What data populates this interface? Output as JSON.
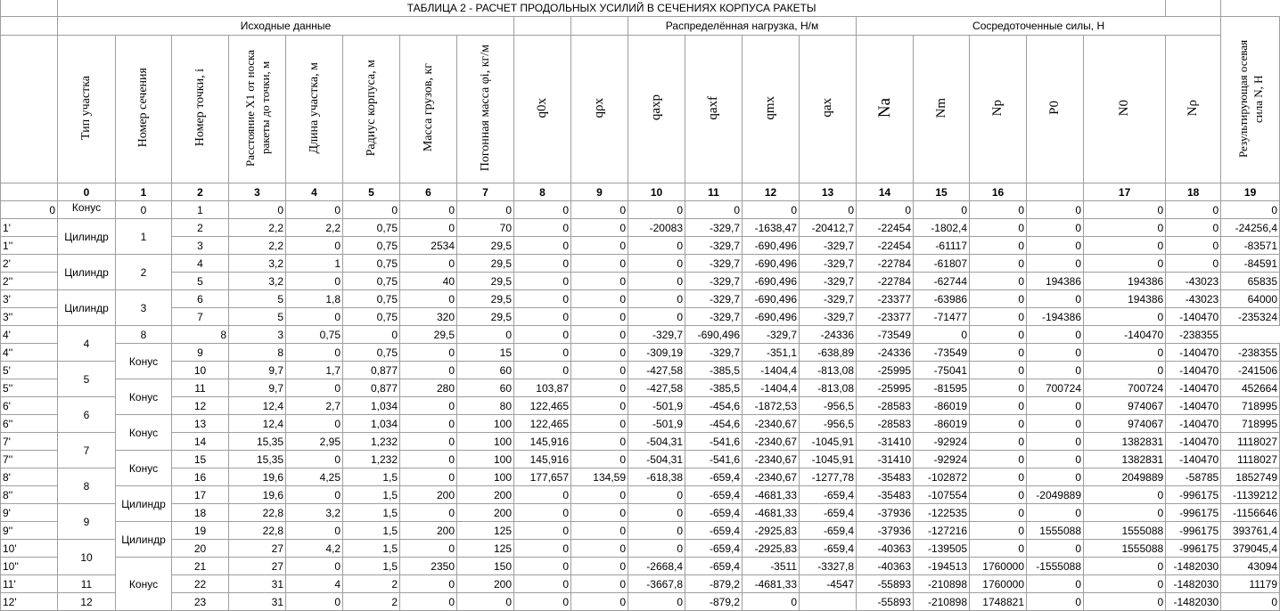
{
  "title": "ТАБЛИЦА 2  - РАСЧЕТ ПРОДОЛЬНЫХ УСИЛИЙ В СЕЧЕНИЯХ КОРПУСА РАКЕТЫ",
  "groups": {
    "source": "Исходные данные",
    "distributed": "Распределённая нагрузка, Н/м",
    "concentrated": "Сосредоточенные силы, Н"
  },
  "headers": {
    "c1": "Тип участка",
    "c2": "Номер сечения",
    "c3": "Номер точки, i",
    "c4": "Расстояние X1 от носка ракеты до точки, м",
    "c5": "Длина участка, м",
    "c6": "Радиус корпуса, м",
    "c7": "Масса грузов, кг",
    "c8": "Погонная масса φi, кг/м",
    "c9": "q0x",
    "c10": "qρx",
    "c11": "qaxp",
    "c12": "qaxf",
    "c13": "qmx",
    "c14": "qax",
    "c15": "Na",
    "c16": "Nm",
    "c17": "Np",
    "c18": "P0",
    "c19": "N0",
    "c20": "Nρ",
    "c21": "Результирующая осевая сила N, Н"
  },
  "col_numbers": [
    "0",
    "1",
    "2",
    "3",
    "4",
    "5",
    "6",
    "7",
    "8",
    "9",
    "10",
    "11",
    "12",
    "13",
    "14",
    "15",
    "16",
    "",
    "17",
    "18",
    "19"
  ],
  "types": [
    "Конус",
    "Цилиндр",
    "Цилиндр",
    "Цилиндр",
    "Конус",
    "Конус",
    "Конус",
    "Конус",
    "Цилиндр",
    "Цилиндр",
    "Конус"
  ],
  "sections": [
    "0",
    "1",
    "2",
    "3",
    "4",
    "5",
    "6",
    "7",
    "8",
    "9",
    "10",
    "11",
    "12"
  ],
  "rows": [
    [
      "0",
      "1",
      "0",
      "0",
      "0",
      "0",
      "0",
      "0",
      "0",
      "0",
      "0",
      "0",
      "0",
      "0",
      "0",
      "0",
      "0",
      "0",
      "0",
      "0"
    ],
    [
      "1'",
      "2",
      "2,2",
      "2,2",
      "0,75",
      "0",
      "70",
      "0",
      "0",
      "-20083",
      "-329,7",
      "-1638,47",
      "-20412,7",
      "-22454",
      "-1802,4",
      "0",
      "0",
      "0",
      "0",
      "-24256,4"
    ],
    [
      "1''",
      "3",
      "2,2",
      "0",
      "0,75",
      "2534",
      "29,5",
      "0",
      "0",
      "0",
      "-329,7",
      "-690,496",
      "-329,7",
      "-22454",
      "-61117",
      "0",
      "0",
      "0",
      "0",
      "-83571"
    ],
    [
      "2'",
      "4",
      "3,2",
      "1",
      "0,75",
      "0",
      "29,5",
      "0",
      "0",
      "0",
      "-329,7",
      "-690,496",
      "-329,7",
      "-22784",
      "-61807",
      "0",
      "0",
      "0",
      "0",
      "-84591"
    ],
    [
      "2''",
      "5",
      "3,2",
      "0",
      "0,75",
      "40",
      "29,5",
      "0",
      "0",
      "0",
      "-329,7",
      "-690,496",
      "-329,7",
      "-22784",
      "-62744",
      "0",
      "194386",
      "194386",
      "-43023",
      "65835"
    ],
    [
      "3'",
      "6",
      "5",
      "1,8",
      "0,75",
      "0",
      "29,5",
      "0",
      "0",
      "0",
      "-329,7",
      "-690,496",
      "-329,7",
      "-23377",
      "-63986",
      "0",
      "0",
      "194386",
      "-43023",
      "64000"
    ],
    [
      "3''",
      "7",
      "5",
      "0",
      "0,75",
      "320",
      "29,5",
      "0",
      "0",
      "0",
      "-329,7",
      "-690,496",
      "-329,7",
      "-23377",
      "-71477",
      "0",
      "-194386",
      "0",
      "-140470",
      "-235324"
    ],
    [
      "4'",
      "8",
      "8",
      "3",
      "0,75",
      "0",
      "29,5",
      "0",
      "0",
      "0",
      "-329,7",
      "-690,496",
      "-329,7",
      "-24336",
      "-73549",
      "0",
      "0",
      "0",
      "-140470",
      "-238355"
    ],
    [
      "4''",
      "9",
      "8",
      "0",
      "0,75",
      "0",
      "15",
      "0",
      "0",
      "-309,19",
      "-329,7",
      "-351,1",
      "-638,89",
      "-24336",
      "-73549",
      "0",
      "0",
      "0",
      "-140470",
      "-238355"
    ],
    [
      "5'",
      "10",
      "9,7",
      "1,7",
      "0,877",
      "0",
      "60",
      "0",
      "0",
      "-427,58",
      "-385,5",
      "-1404,4",
      "-813,08",
      "-25995",
      "-75041",
      "0",
      "0",
      "0",
      "-140470",
      "-241506"
    ],
    [
      "5''",
      "11",
      "9,7",
      "0",
      "0,877",
      "280",
      "60",
      "103,87",
      "0",
      "-427,58",
      "-385,5",
      "-1404,4",
      "-813,08",
      "-25995",
      "-81595",
      "0",
      "700724",
      "700724",
      "-140470",
      "452664"
    ],
    [
      "6'",
      "12",
      "12,4",
      "2,7",
      "1,034",
      "0",
      "80",
      "122,465",
      "0",
      "-501,9",
      "-454,6",
      "-1872,53",
      "-956,5",
      "-28583",
      "-86019",
      "0",
      "0",
      "974067",
      "-140470",
      "718995"
    ],
    [
      "6''",
      "13",
      "12,4",
      "0",
      "1,034",
      "0",
      "100",
      "122,465",
      "0",
      "-501,9",
      "-454,6",
      "-2340,67",
      "-956,5",
      "-28583",
      "-86019",
      "0",
      "0",
      "974067",
      "-140470",
      "718995"
    ],
    [
      "7'",
      "14",
      "15,35",
      "2,95",
      "1,232",
      "0",
      "100",
      "145,916",
      "0",
      "-504,31",
      "-541,6",
      "-2340,67",
      "-1045,91",
      "-31410",
      "-92924",
      "0",
      "0",
      "1382831",
      "-140470",
      "1118027"
    ],
    [
      "7''",
      "15",
      "15,35",
      "0",
      "1,232",
      "0",
      "100",
      "145,916",
      "0",
      "-504,31",
      "-541,6",
      "-2340,67",
      "-1045,91",
      "-31410",
      "-92924",
      "0",
      "0",
      "1382831",
      "-140470",
      "1118027"
    ],
    [
      "8'",
      "16",
      "19,6",
      "4,25",
      "1,5",
      "0",
      "100",
      "177,657",
      "134,59",
      "-618,38",
      "-659,4",
      "-2340,67",
      "-1277,78",
      "-35483",
      "-102872",
      "0",
      "0",
      "2049889",
      "-58785",
      "1852749"
    ],
    [
      "8''",
      "17",
      "19,6",
      "0",
      "1,5",
      "200",
      "200",
      "0",
      "0",
      "0",
      "-659,4",
      "-4681,33",
      "-659,4",
      "-35483",
      "-107554",
      "0",
      "-2049889",
      "0",
      "-996175",
      "-1139212"
    ],
    [
      "9'",
      "18",
      "22,8",
      "3,2",
      "1,5",
      "0",
      "200",
      "0",
      "0",
      "0",
      "-659,4",
      "-4681,33",
      "-659,4",
      "-37936",
      "-122535",
      "0",
      "0",
      "0",
      "-996175",
      "-1156646"
    ],
    [
      "9''",
      "19",
      "22,8",
      "0",
      "1,5",
      "200",
      "125",
      "0",
      "0",
      "0",
      "-659,4",
      "-2925,83",
      "-659,4",
      "-37936",
      "-127216",
      "0",
      "1555088",
      "1555088",
      "-996175",
      "393761,4"
    ],
    [
      "10'",
      "20",
      "27",
      "4,2",
      "1,5",
      "0",
      "125",
      "0",
      "0",
      "0",
      "-659,4",
      "-2925,83",
      "-659,4",
      "-40363",
      "-139505",
      "0",
      "0",
      "1555088",
      "-996175",
      "379045,4"
    ],
    [
      "10''",
      "21",
      "27",
      "0",
      "1,5",
      "2350",
      "150",
      "0",
      "0",
      "-2668,4",
      "-659,4",
      "-3511",
      "-3327,8",
      "-40363",
      "-194513",
      "1760000",
      "-1555088",
      "0",
      "-1482030",
      "43094"
    ],
    [
      "11'",
      "22",
      "31",
      "4",
      "2",
      "0",
      "200",
      "0",
      "0",
      "-3667,8",
      "-879,2",
      "-4681,33",
      "-4547",
      "-55893",
      "-210898",
      "1760000",
      "0",
      "0",
      "-1482030",
      "11179"
    ],
    [
      "12'",
      "23",
      "31",
      "0",
      "2",
      "0",
      "0",
      "0",
      "0",
      "0",
      "-879,2",
      "0",
      "",
      "-55893",
      "-210898",
      "1748821",
      "0",
      "0",
      "-1482030",
      "0"
    ]
  ]
}
